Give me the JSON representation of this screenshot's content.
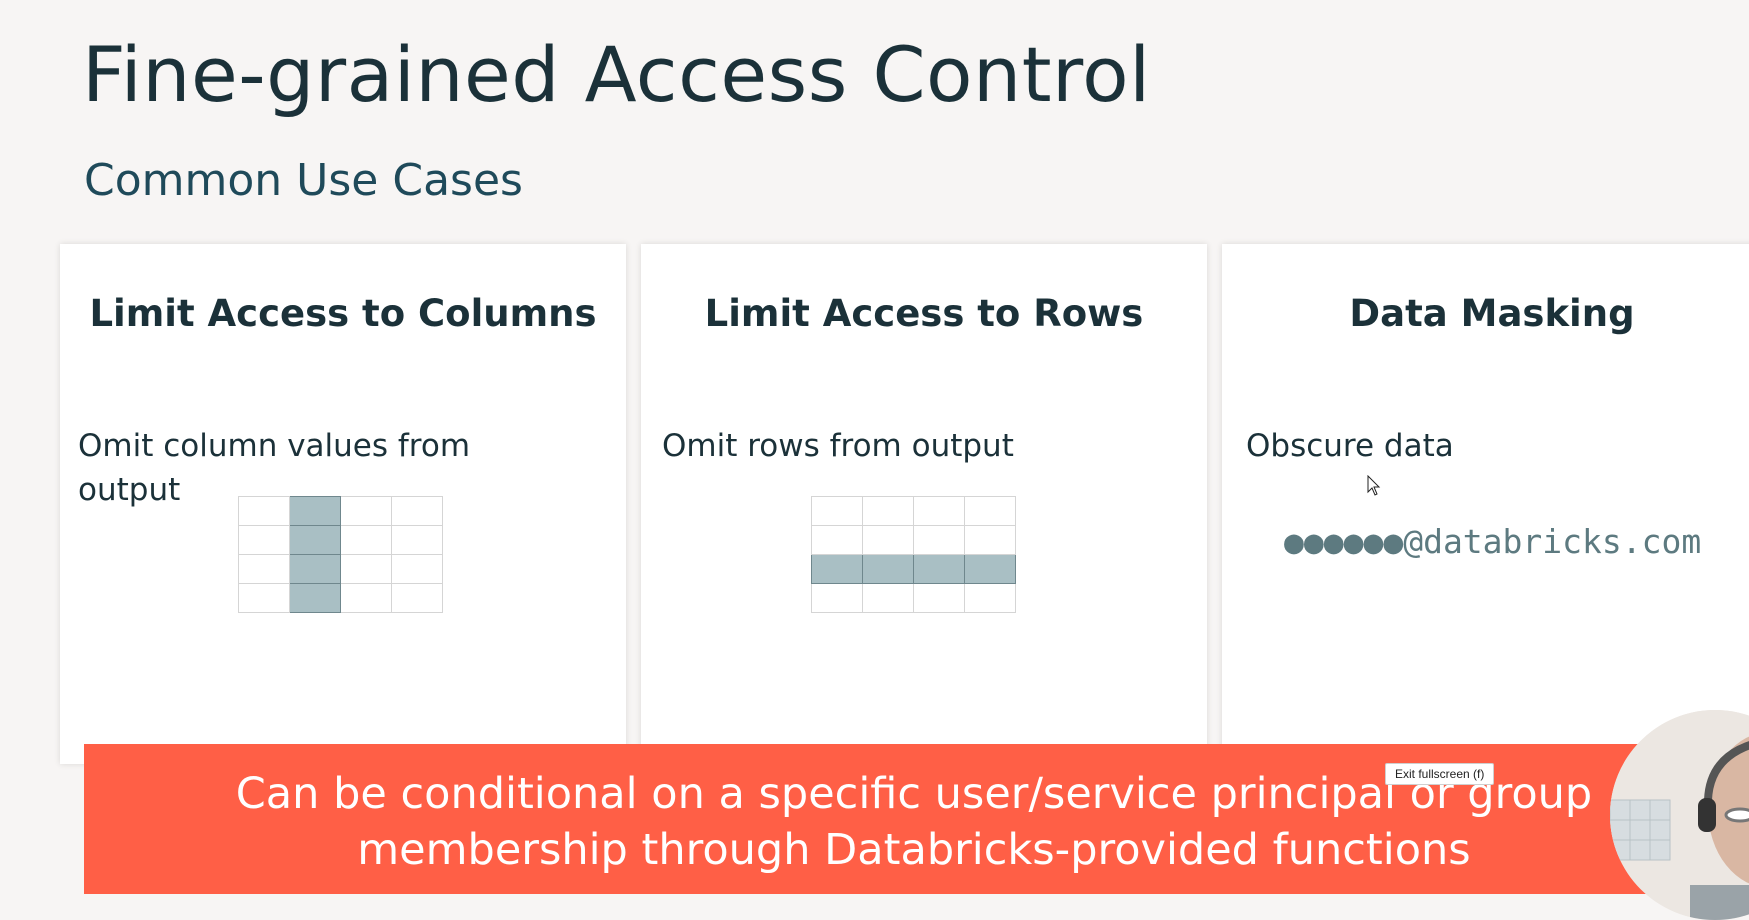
{
  "slide": {
    "title": "Fine-grained Access Control",
    "subtitle": "Common Use Cases"
  },
  "cards": [
    {
      "heading": "Limit Access to Columns",
      "description": "Omit column values from output",
      "illustration": {
        "type": "table-grid",
        "rows": 4,
        "cols": 4,
        "highlight": "column 2"
      }
    },
    {
      "heading": "Limit Access to Rows",
      "description": "Omit rows from output",
      "illustration": {
        "type": "table-grid",
        "rows": 4,
        "cols": 4,
        "highlight": "row 3"
      }
    },
    {
      "heading": "Data Masking",
      "description": "Obscure data",
      "example": "●●●●●●@databricks.com"
    }
  ],
  "banner": {
    "line1": "Can be conditional on a specific user/service principal or group",
    "line2": "membership through Databricks-provided functions"
  },
  "tooltip": {
    "text": "Exit fullscreen (f)"
  },
  "colors": {
    "heading": "#1b3139",
    "subtitle": "#1f4a5a",
    "banner": "#ff5f46",
    "highlight": "#a9bfc4",
    "background": "#f7f5f4"
  },
  "icons": {
    "cursor": "mouse-pointer-icon"
  }
}
